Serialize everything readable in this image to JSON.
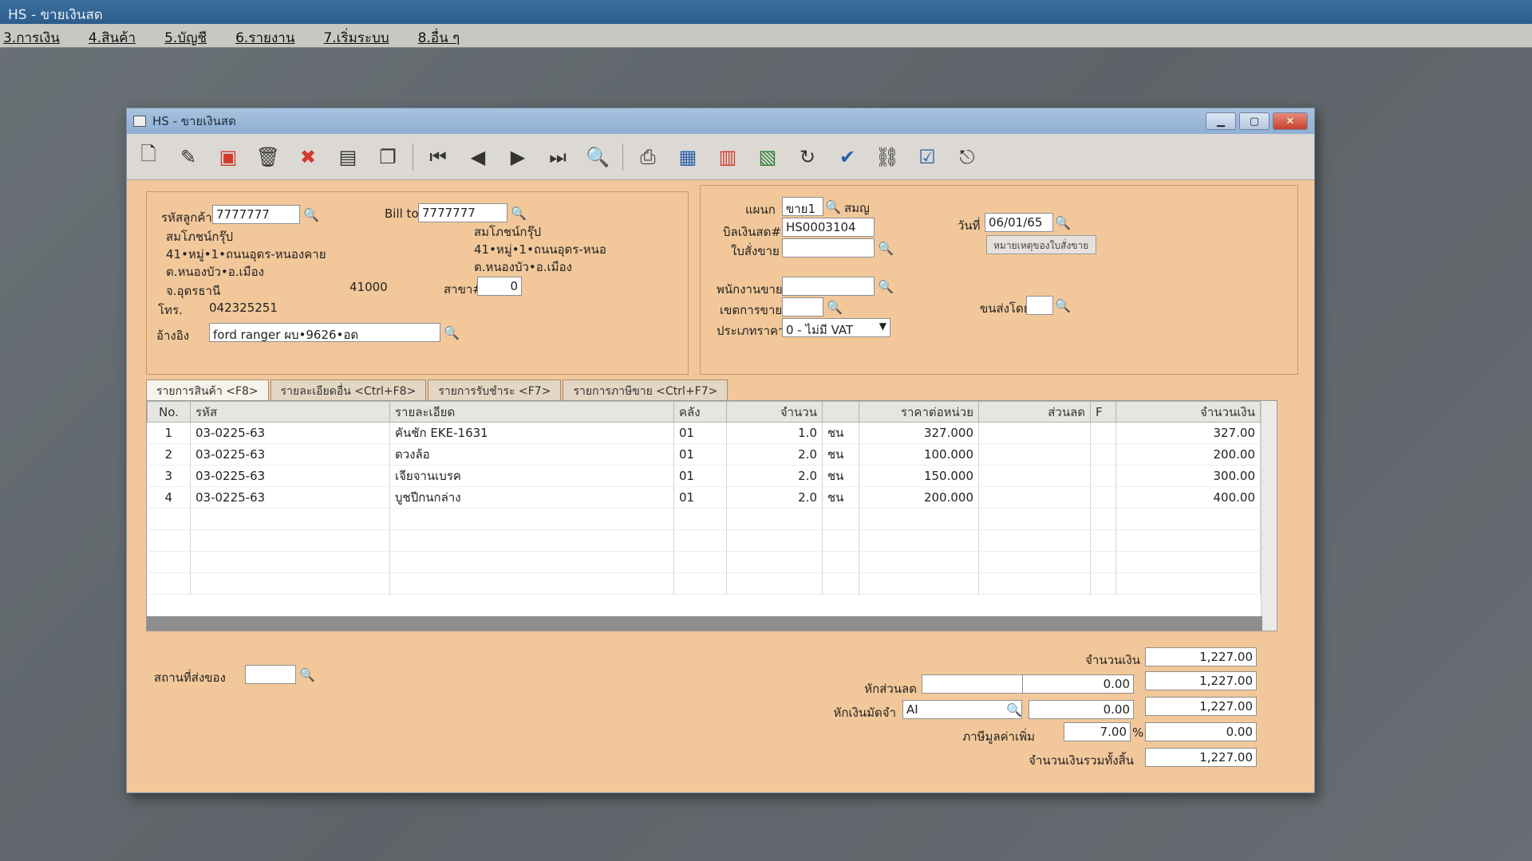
{
  "app": {
    "title": "HS - ขายเงินสด",
    "menu": [
      "3.การเงิน",
      "4.สินค้า",
      "5.บัญชี",
      "6.รายงาน",
      "7.เริ่มระบบ",
      "8.อื่น ๆ"
    ]
  },
  "window": {
    "title": "HS - ขายเงินสด"
  },
  "toolbar": {
    "icons": [
      "new-doc",
      "edit",
      "void",
      "delete",
      "cancel",
      "save",
      "copy",
      "first",
      "prev",
      "next",
      "last",
      "search",
      "print",
      "calc",
      "report",
      "export",
      "recal",
      "approve",
      "link",
      "ok",
      "exit"
    ]
  },
  "customer": {
    "code_label": "รหัสลูกค้า",
    "code": "7777777",
    "name": "สมโภชน์กรุ๊ป",
    "addr1": "41•หมู่•1•ถนนอุดร-หนองคาย",
    "addr2": "ต.หนองบัว•อ.เมือง",
    "addr3": "จ.อุดรธานี",
    "zip": "41000",
    "tel_label": "โทร.",
    "tel": "042325251",
    "ref_label": "อ้างอิง",
    "ref": "ford ranger ผบ•9626•อด",
    "billto_label": "Bill to",
    "billto_code": "7777777",
    "billto_name": "สมโภชน์กรุ๊ป",
    "billto_addr1": "41•หมู่•1•ถนนอุดร-หนอ",
    "billto_addr2": "ต.หนองบัว•อ.เมือง",
    "branch_label": "สาขา#",
    "branch": "0"
  },
  "doc": {
    "dept_label": "แผนก",
    "dept": "ขาย1",
    "dept_name": "สมญ",
    "bill_label": "บิลเงินสด#",
    "bill_no": "HS0003104",
    "order_label": "ใบสั่งขาย",
    "order": "",
    "date_label": "วันที่",
    "date": "06/01/65",
    "note_button": "หมายเหตุของใบสั่งขาย",
    "salesman_label": "พนักงานขาย",
    "salesman": "",
    "area_label": "เขตการขาย",
    "area": "",
    "price_type_label": "ประเภทราคา",
    "price_type": "0 - ไม่มี VAT",
    "ship_label": "ขนส่งโดย",
    "ship": ""
  },
  "tabs": [
    "รายการสินค้า <F8>",
    "รายละเอียดอื่น <Ctrl+F8>",
    "รายการรับชำระ <F7>",
    "รายการภาษีขาย <Ctrl+F7>"
  ],
  "grid": {
    "headers": [
      "No.",
      "รหัส",
      "รายละเอียด",
      "คลัง",
      "จำนวน",
      "",
      "ราคาต่อหน่วย",
      "ส่วนลด",
      "F",
      "จำนวนเงิน"
    ],
    "rows": [
      [
        "1",
        "03-0225-63",
        "คันชัก EKE-1631",
        "01",
        "1.0",
        "ชน",
        "327.000",
        "",
        "",
        "327.00"
      ],
      [
        "2",
        "03-0225-63",
        "ดวงล้อ",
        "01",
        "2.0",
        "ชน",
        "100.000",
        "",
        "",
        "200.00"
      ],
      [
        "3",
        "03-0225-63",
        "เจียจานเบรค",
        "01",
        "2.0",
        "ชน",
        "150.000",
        "",
        "",
        "300.00"
      ],
      [
        "4",
        "03-0225-63",
        "บูชปีกนกล่าง",
        "01",
        "2.0",
        "ชน",
        "200.000",
        "",
        "",
        "400.00"
      ]
    ]
  },
  "totals": {
    "place_label": "สถานที่ส่งของ",
    "place": "",
    "amount_label": "จำนวนเงิน",
    "amount": "1,227.00",
    "discount_label": "หักส่วนลด",
    "discount_code": "",
    "discount": "0.00",
    "after_discount": "1,227.00",
    "deposit_label": "หักเงินมัดจำ",
    "deposit_code": "AI",
    "deposit": "0.00",
    "after_deposit": "1,227.00",
    "vat_label": "ภาษีมูลค่าเพิ่ม",
    "vat_rate": "7.00",
    "vat_pct": "%",
    "vat": "0.00",
    "grand_label": "จำนวนเงินรวมทั้งสิ้น",
    "grand": "1,227.00"
  }
}
